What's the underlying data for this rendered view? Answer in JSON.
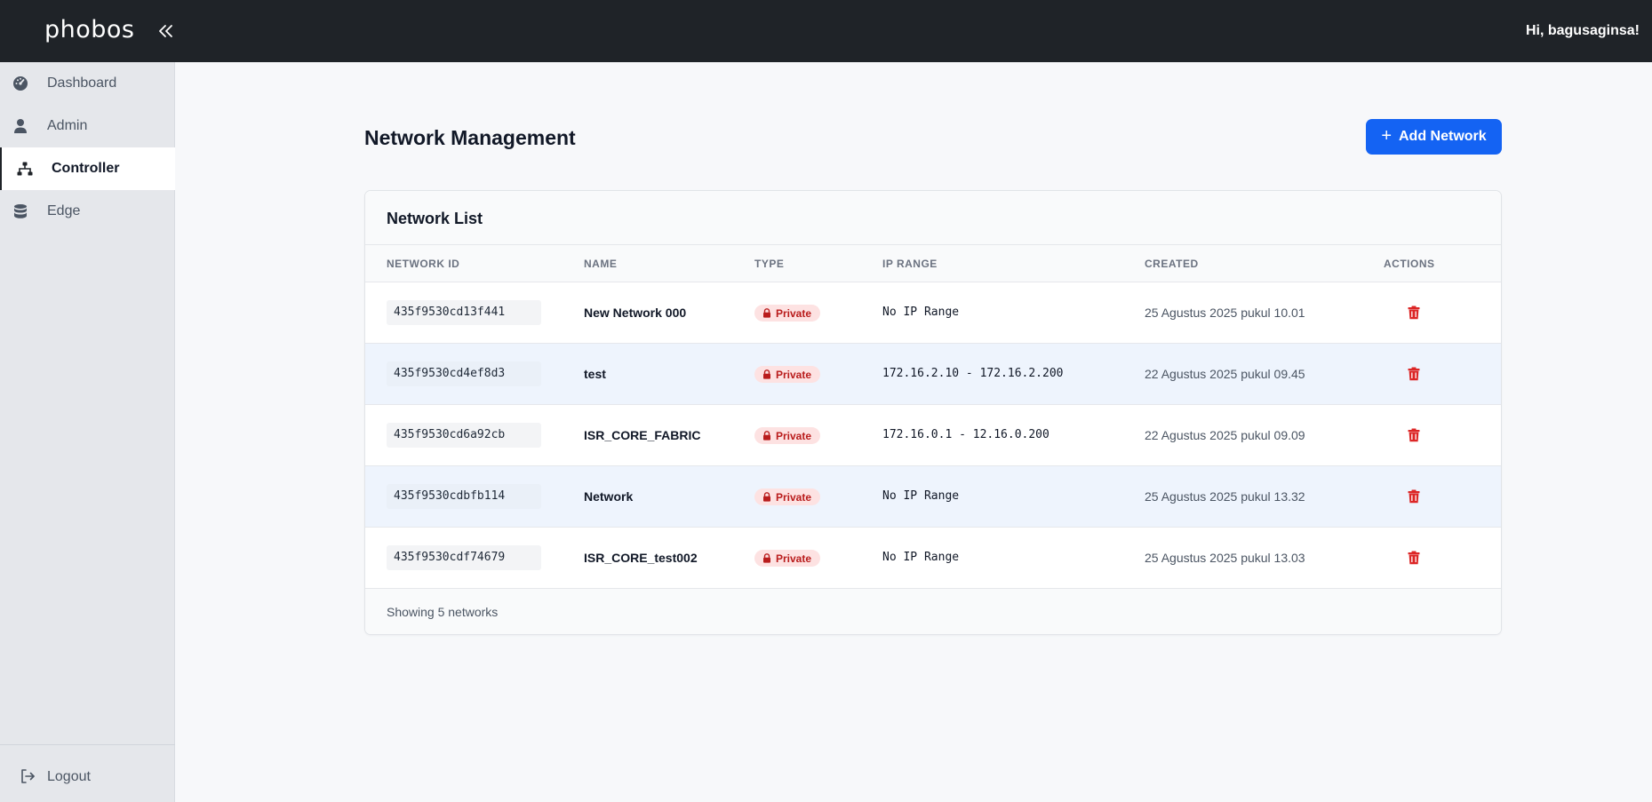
{
  "app": {
    "logo": "phobos",
    "greeting": "Hi, bagusaginsa!"
  },
  "sidebar": {
    "items": [
      {
        "label": "Dashboard",
        "icon": "dashboard-icon"
      },
      {
        "label": "Admin",
        "icon": "user-icon"
      },
      {
        "label": "Controller",
        "icon": "network-icon",
        "active": true
      },
      {
        "label": "Edge",
        "icon": "database-icon"
      }
    ],
    "logout": {
      "label": "Logout",
      "icon": "logout-icon"
    }
  },
  "main": {
    "title": "Network Management",
    "add_button_label": "Add Network",
    "card_title": "Network List",
    "columns": [
      "NETWORK ID",
      "NAME",
      "TYPE",
      "IP RANGE",
      "CREATED",
      "ACTIONS"
    ],
    "rows": [
      {
        "id": "435f9530cd13f441",
        "name": "New Network 000",
        "type": "Private",
        "ip_range": "No IP Range",
        "created": "25 Agustus 2025 pukul 10.01"
      },
      {
        "id": "435f9530cd4ef8d3",
        "name": "test",
        "type": "Private",
        "ip_range": "172.16.2.10 - 172.16.2.200",
        "created": "22 Agustus 2025 pukul 09.45"
      },
      {
        "id": "435f9530cd6a92cb",
        "name": "ISR_CORE_FABRIC",
        "type": "Private",
        "ip_range": "172.16.0.1 - 12.16.0.200",
        "created": "22 Agustus 2025 pukul 09.09"
      },
      {
        "id": "435f9530cdbfb114",
        "name": "Network",
        "type": "Private",
        "ip_range": "No IP Range",
        "created": "25 Agustus 2025 pukul 13.32"
      },
      {
        "id": "435f9530cdf74679",
        "name": "ISR_CORE_test002",
        "type": "Private",
        "ip_range": "No IP Range",
        "created": "25 Agustus 2025 pukul 13.03"
      }
    ],
    "footer": "Showing 5 networks"
  },
  "colors": {
    "topbar": "#1f2328",
    "accent": "#1463f3",
    "danger": "#dc2626",
    "badge_bg": "#fde2e2"
  }
}
